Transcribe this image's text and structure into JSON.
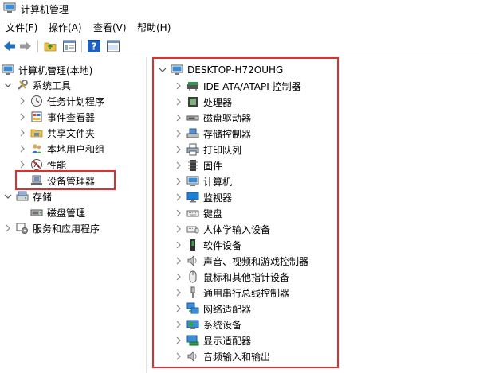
{
  "window": {
    "title": "计算机管理"
  },
  "menubar": [
    {
      "label": "文件(F)"
    },
    {
      "label": "操作(A)"
    },
    {
      "label": "查看(V)"
    },
    {
      "label": "帮助(H)"
    }
  ],
  "left_tree": {
    "root": {
      "label": "计算机管理(本地)"
    },
    "system_tools": {
      "label": "系统工具"
    },
    "task_scheduler": {
      "label": "任务计划程序"
    },
    "event_viewer": {
      "label": "事件查看器"
    },
    "shared_folders": {
      "label": "共享文件夹"
    },
    "local_users": {
      "label": "本地用户和组"
    },
    "performance": {
      "label": "性能"
    },
    "device_manager": {
      "label": "设备管理器"
    },
    "storage": {
      "label": "存储"
    },
    "disk_management": {
      "label": "磁盘管理"
    },
    "services": {
      "label": "服务和应用程序"
    }
  },
  "device_tree": {
    "root": {
      "label": "DESKTOP-H72OUHG"
    },
    "categories": [
      {
        "label": "IDE ATA/ATAPI 控制器",
        "icon": "ide-controller-icon"
      },
      {
        "label": "处理器",
        "icon": "processor-icon"
      },
      {
        "label": "磁盘驱动器",
        "icon": "disk-drive-icon"
      },
      {
        "label": "存储控制器",
        "icon": "storage-controller-icon"
      },
      {
        "label": "打印队列",
        "icon": "printer-icon"
      },
      {
        "label": "固件",
        "icon": "firmware-icon"
      },
      {
        "label": "计算机",
        "icon": "computer-icon"
      },
      {
        "label": "监视器",
        "icon": "monitor-icon"
      },
      {
        "label": "键盘",
        "icon": "keyboard-icon"
      },
      {
        "label": "人体学输入设备",
        "icon": "hid-icon"
      },
      {
        "label": "软件设备",
        "icon": "software-device-icon"
      },
      {
        "label": "声音、视频和游戏控制器",
        "icon": "sound-icon"
      },
      {
        "label": "鼠标和其他指针设备",
        "icon": "mouse-icon"
      },
      {
        "label": "通用串行总线控制器",
        "icon": "usb-icon"
      },
      {
        "label": "网络适配器",
        "icon": "network-adapter-icon"
      },
      {
        "label": "系统设备",
        "icon": "system-device-icon"
      },
      {
        "label": "显示适配器",
        "icon": "display-adapter-icon"
      },
      {
        "label": "音频输入和输出",
        "icon": "audio-io-icon"
      }
    ]
  },
  "colors": {
    "highlight": "#e02f2f",
    "toolbar_arrow": "#1f6fbf",
    "help": "#1f5fbf"
  }
}
